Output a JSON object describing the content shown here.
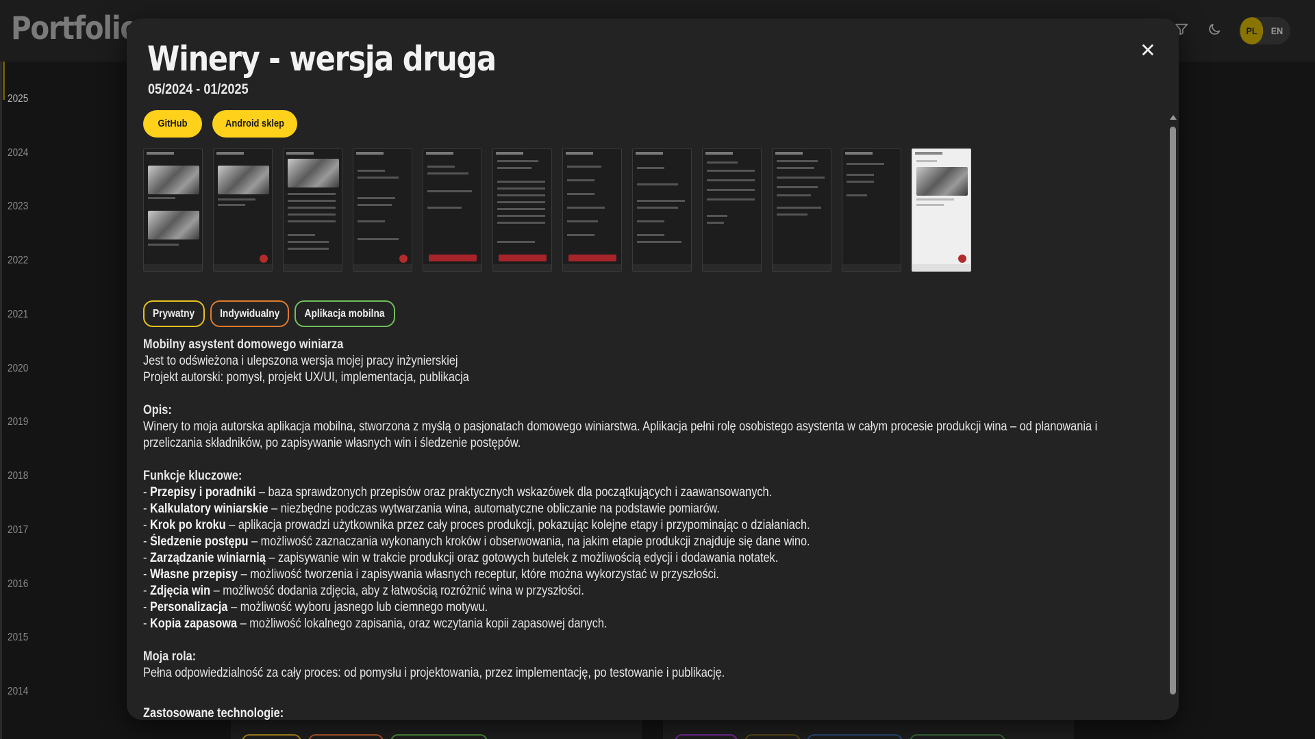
{
  "header": {
    "brand": "Portfolio",
    "brand_tail": "Portfolio",
    "filter_icon": "filter-icon",
    "theme_icon": "moon-icon",
    "languages": [
      "PL",
      "EN"
    ],
    "active_language": "PL"
  },
  "timeline": {
    "years": [
      "2025",
      "2024",
      "2023",
      "2022",
      "2021",
      "2020",
      "2019",
      "2018",
      "2017",
      "2016",
      "2015",
      "2014"
    ],
    "active_year": "2025"
  },
  "modal": {
    "title": "Winery - wersja druga",
    "dates": "05/2024 - 01/2025",
    "close_icon": "close-icon",
    "close_glyph": "✕",
    "links": {
      "github": "GitHub",
      "android": "Android sklep"
    },
    "tags": [
      {
        "label": "Prywatny",
        "color": "#e8c21e"
      },
      {
        "label": "Indywidualny",
        "color": "#e07a2e"
      },
      {
        "label": "Aplikacja mobilna",
        "color": "#6fbf5a"
      }
    ],
    "intro": {
      "heading": "Mobilny asystent domowego winiarza",
      "line1": "Jest to odświeżona i ulepszona wersja mojej pracy inżynierskiej",
      "line2": "Projekt autorski: pomysł, projekt UX/UI, implementacja, publikacja"
    },
    "description": {
      "heading": "Opis:",
      "text": "Winery to moja autorska aplikacja mobilna, stworzona z myślą o pasjonatach domowego winiarstwa. Aplikacja pełni rolę osobistego asystenta w całym procesie produkcji wina – od planowania i przeliczania składników, po zapisywanie własnych win i śledzenie postępów."
    },
    "features": {
      "heading": "Funkcje kluczowe:",
      "items": [
        {
          "name": "Przepisy i poradniki",
          "text": " – baza sprawdzonych przepisów oraz praktycznych wskazówek dla początkujących i zaawansowanych."
        },
        {
          "name": "Kalkulatory winiarskie",
          "text": " – niezbędne podczas wytwarzania wina, automatyczne obliczanie na podstawie pomiarów."
        },
        {
          "name": "Krok po kroku",
          "text": " – aplikacja prowadzi użytkownika przez cały proces produkcji, pokazując kolejne etapy i przypominając o działaniach."
        },
        {
          "name": "Śledzenie postępu",
          "text": " – możliwość zaznaczania wykonanych kroków i obserwowania, na jakim etapie produkcji znajduje się dane wino."
        },
        {
          "name": "Zarządzanie winiarnią",
          "text": " – zapisywanie win w trakcie produkcji oraz gotowych butelek z możliwością edycji i dodawania notatek."
        },
        {
          "name": "Własne przepisy",
          "text": " – możliwość tworzenia i zapisywania własnych receptur, które można wykorzystać w przyszłości."
        },
        {
          "name": "Zdjęcia win",
          "text": " – możliwość dodania zdjęcia, aby z łatwością rozróżnić wina w przyszłości."
        },
        {
          "name": "Personalizacja",
          "text": " – możliwość wyboru jasnego lub ciemnego motywu."
        },
        {
          "name": "Kopia zapasowa",
          "text": " – możliwość lokalnego zapisania, oraz wczytania kopii zapasowej danych."
        }
      ]
    },
    "role": {
      "heading": "Moja rola:",
      "text": "Pełna odpowiedzialność za cały proces: od pomysłu i projektowania, przez implementację, po testowanie i publikację."
    },
    "technologies": {
      "heading": "Zastosowane technologie:",
      "chip_colors": [
        "#1f6fc9",
        "#e0502a",
        "#2b5fd9",
        "#d01c3a",
        "#0d0d0d",
        "#0aa7c9",
        "#1a1ae0",
        "#4fa8e8",
        "#d84a9a",
        "#5a38c9"
      ]
    },
    "screenshots_count": 12
  },
  "background": {
    "pill_colors": [
      "#b58a1c",
      "#b55a2a",
      "#4f8f3a",
      "#7a2a9a",
      "#5a4a1a",
      "#2a4a7a",
      "#3a6a3a"
    ]
  }
}
